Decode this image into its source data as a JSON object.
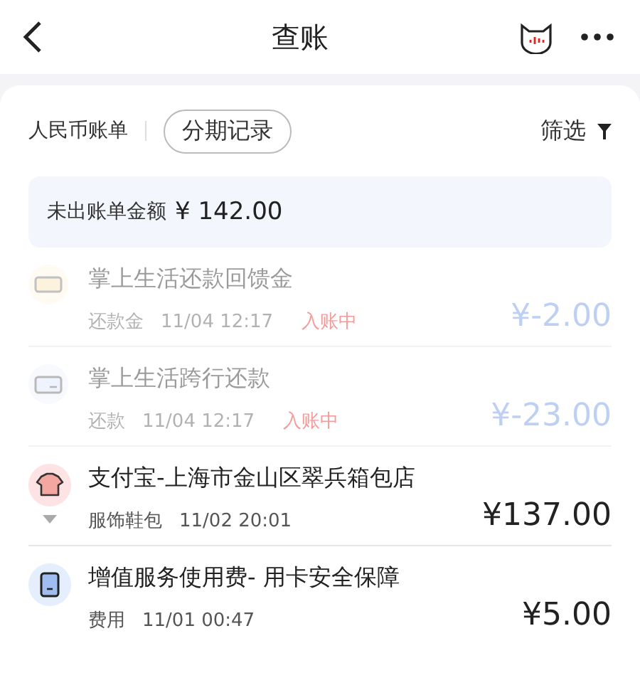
{
  "header": {
    "title": "查账"
  },
  "toolbar": {
    "bill_label": "人民币账单",
    "installment_button": "分期记录",
    "filter_button": "筛选"
  },
  "summary": {
    "label": "未出账单金额",
    "amount": "¥ 142.00"
  },
  "transactions": [
    {
      "kind": "voucher",
      "title": "掌上生活还款回馈金",
      "category": "还款金",
      "time": "11/04 12:17",
      "status": "入账中",
      "amount": "¥-2.00",
      "pending": true,
      "expandable": false
    },
    {
      "kind": "card",
      "title": "掌上生活跨行还款",
      "category": "还款",
      "time": "11/04 12:17",
      "status": "入账中",
      "amount": "¥-23.00",
      "pending": true,
      "expandable": false
    },
    {
      "kind": "shirt",
      "title": "支付宝-上海市金山区翠兵箱包店",
      "category": "服饰鞋包",
      "time": "11/02 20:01",
      "amount": "¥137.00",
      "pending": false,
      "expandable": true
    },
    {
      "kind": "device",
      "title": "增值服务使用费- 用卡安全保障",
      "category": "费用",
      "time": "11/01 00:47",
      "amount": "¥5.00",
      "pending": false,
      "expandable": false
    }
  ]
}
